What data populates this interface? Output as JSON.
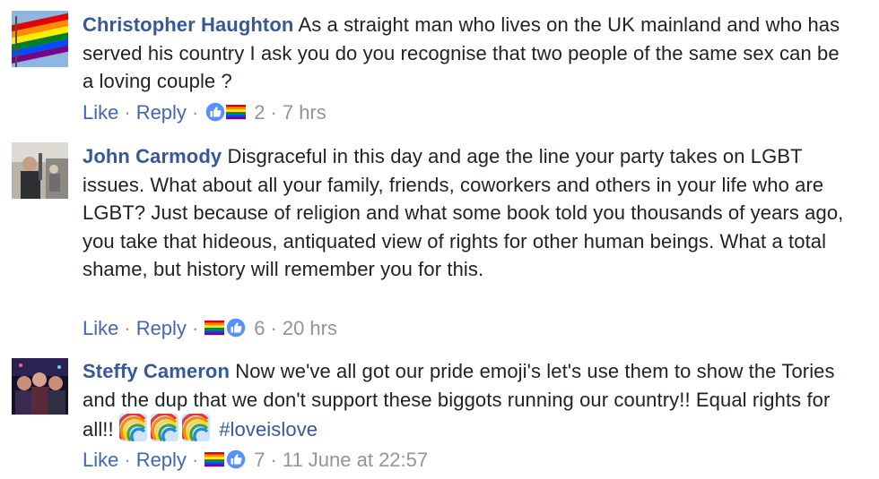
{
  "comments": [
    {
      "author": "Christopher Haughton",
      "text": "As a straight man who lives on the UK mainland and who has served his country I ask you do you recognise that two people of the same sex can be a loving couple ?",
      "hashtag": "",
      "inline_emoji": [],
      "like_label": "Like",
      "reply_label": "Reply",
      "reactions": [
        "like-icon",
        "rainbow-flag-icon"
      ],
      "reaction_count": "2",
      "timestamp": "7 hrs",
      "avatar": "rainbow-flag-avatar"
    },
    {
      "author": "John Carmody",
      "text": "Disgraceful in this day and age the line your party takes on LGBT issues. What about all your family, friends, coworkers and others in your life who are LGBT? Just because of religion and what some book told you thousands of years ago, you take that hideous, antiquated view of rights for other human beings. What a total shame, but history will remember you for this.",
      "hashtag": "",
      "inline_emoji": [],
      "like_label": "Like",
      "reply_label": "Reply",
      "reactions": [
        "rainbow-flag-icon",
        "like-icon"
      ],
      "reaction_count": "6",
      "timestamp": "20 hrs",
      "avatar": "street-photo-avatar"
    },
    {
      "author": "Steffy Cameron",
      "text": "Now we've all got our pride emoji's let's use them to show the Tories and the dup that we don't support these biggots running our country!! Equal rights for all!!",
      "hashtag": "#loveislove",
      "inline_emoji": [
        "rainbow-icon",
        "rainbow-icon",
        "rainbow-icon"
      ],
      "like_label": "Like",
      "reply_label": "Reply",
      "reactions": [
        "rainbow-flag-icon",
        "like-icon"
      ],
      "reaction_count": "7",
      "timestamp": "11 June at 22:57",
      "avatar": "group-selfie-avatar"
    }
  ],
  "colors": {
    "author_link": "#365899",
    "action_link": "#4267b2",
    "meta_gray": "#90949c",
    "body_text": "#1d2129",
    "like_blue": "#5890ff"
  }
}
